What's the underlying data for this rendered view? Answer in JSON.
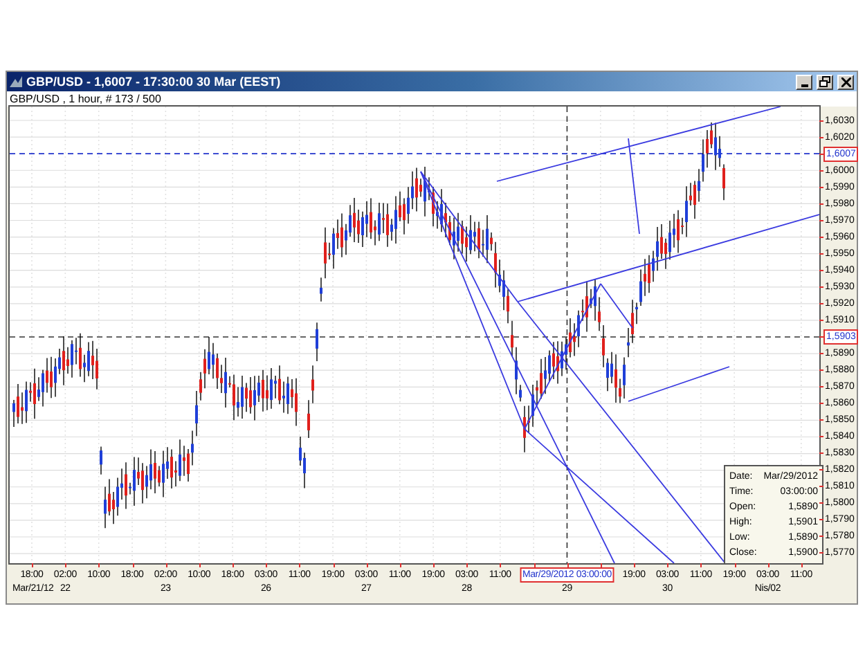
{
  "window": {
    "title": "GBP/USD - 1,6007 - 17:30:00  30 Mar (EEST)"
  },
  "chart": {
    "caption": "GBP/USD , 1 hour, # 173 / 500",
    "price_axis": [
      {
        "kind": "label",
        "text": "1,6030"
      },
      {
        "kind": "label",
        "text": "1,6020"
      },
      {
        "kind": "marker",
        "text": "1,6007"
      },
      {
        "kind": "label",
        "text": "1,6000"
      },
      {
        "kind": "label",
        "text": "1,5990"
      },
      {
        "kind": "label",
        "text": "1,5980"
      },
      {
        "kind": "label",
        "text": "1,5970"
      },
      {
        "kind": "label",
        "text": "1,5960"
      },
      {
        "kind": "label",
        "text": "1,5950"
      },
      {
        "kind": "label",
        "text": "1,5940"
      },
      {
        "kind": "label",
        "text": "1,5930"
      },
      {
        "kind": "label",
        "text": "1,5920"
      },
      {
        "kind": "label",
        "text": "1,5910"
      },
      {
        "kind": "marker",
        "text": "1,5903"
      },
      {
        "kind": "label",
        "text": "1,5890"
      },
      {
        "kind": "label",
        "text": "1,5880"
      },
      {
        "kind": "label",
        "text": "1,5870"
      },
      {
        "kind": "label",
        "text": "1,5860"
      },
      {
        "kind": "label",
        "text": "1,5850"
      },
      {
        "kind": "label",
        "text": "1,5840"
      },
      {
        "kind": "label",
        "text": "1,5830"
      },
      {
        "kind": "label",
        "text": "1,5820"
      },
      {
        "kind": "label",
        "text": "1,5810"
      },
      {
        "kind": "label",
        "text": "1,5800"
      },
      {
        "kind": "label",
        "text": "1,5790"
      },
      {
        "kind": "label",
        "text": "1,5780"
      },
      {
        "kind": "label",
        "text": "1,5770"
      }
    ],
    "time_axis": [
      {
        "time": "18:00",
        "date": "Mar/21/12"
      },
      {
        "time": "02:00",
        "date": "22"
      },
      {
        "time": "10:00"
      },
      {
        "time": "18:00"
      },
      {
        "time": "02:00",
        "date": "23"
      },
      {
        "time": "10:00"
      },
      {
        "time": "18:00"
      },
      {
        "time": "03:00",
        "date": "26"
      },
      {
        "time": "11:00"
      },
      {
        "time": "19:00"
      },
      {
        "time": "03:00",
        "date": "27"
      },
      {
        "time": "11:00"
      },
      {
        "time": "19:00"
      },
      {
        "time": "03:00",
        "date": "28"
      },
      {
        "time": "11:00"
      },
      {
        "kind": "crosshair",
        "time": "Mar/29/2012 03:00:00",
        "date": "29"
      },
      {
        "time": "19:00"
      },
      {
        "time": "03:00",
        "date": "30"
      },
      {
        "time": "11:00"
      },
      {
        "time": "19:00"
      },
      {
        "time": "03:00",
        "date": "Nis/02"
      },
      {
        "time": "11:00"
      }
    ],
    "data_window": [
      {
        "label": "Date:",
        "value": "Mar/29/2012"
      },
      {
        "label": "Time:",
        "value": "03:00:00"
      },
      {
        "label": "Open:",
        "value": "1,5890"
      },
      {
        "label": "High:",
        "value": "1,5901"
      },
      {
        "label": "Low:",
        "value": "1,5890"
      },
      {
        "label": "Close:",
        "value": "1,5900"
      }
    ]
  }
}
